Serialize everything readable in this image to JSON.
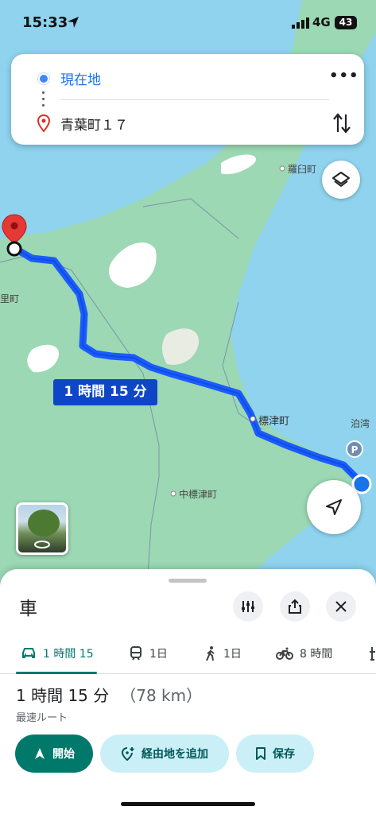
{
  "status_bar": {
    "time": "15:33",
    "network": "4G",
    "battery": "43"
  },
  "search": {
    "origin": "現在地",
    "destination": "青葉町１７"
  },
  "map": {
    "route_time_label": "1 時間 15 分",
    "places": [
      {
        "name": "羅臼町"
      },
      {
        "name": "里町"
      },
      {
        "name": "標津町"
      },
      {
        "name": "泊湾"
      },
      {
        "name": "中標津町"
      }
    ],
    "route_color": "#1a5cff",
    "land_color": "#9bd8b3",
    "water_color": "#8fd3ee"
  },
  "sheet": {
    "mode_title": "車",
    "tabs": [
      {
        "icon": "car-icon",
        "label": "1 時間 15"
      },
      {
        "icon": "train-icon",
        "label": "1日"
      },
      {
        "icon": "walk-icon",
        "label": "1日"
      },
      {
        "icon": "bike-icon",
        "label": "8 時間"
      }
    ],
    "duration": "1 時間 15 分",
    "distance": "（78 km）",
    "route_note": "最速ルート",
    "start_label": "開始",
    "add_waypoint_label": "経由地を追加",
    "save_label": "保存",
    "accent_color": "#00796b"
  }
}
